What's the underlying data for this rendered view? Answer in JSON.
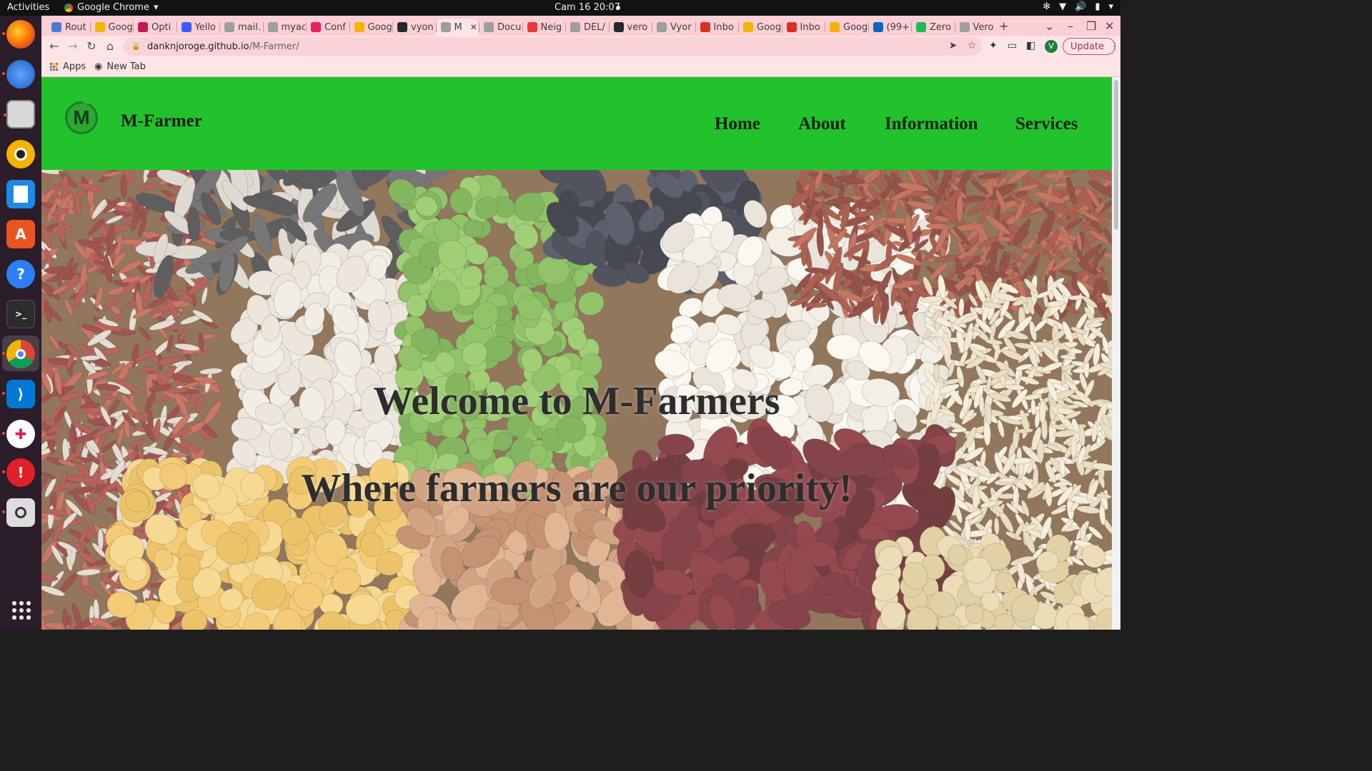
{
  "system": {
    "activities": "Activities",
    "app_name": "Google Chrome",
    "clock": "Cam 16  20:07"
  },
  "dock": {
    "apps": [
      "Firefox",
      "Thunderbird",
      "Files",
      "Rhythmbox",
      "LibreOffice Writer",
      "Ubuntu Software",
      "Help",
      "Terminal",
      "Google Chrome",
      "Visual Studio Code",
      "Slack",
      "Update Notifier",
      "Magnifier"
    ]
  },
  "browser": {
    "tabs": [
      {
        "label": "Rout",
        "color": "#4a7bd5"
      },
      {
        "label": "Goog",
        "color": "#f4b400"
      },
      {
        "label": "Opti",
        "color": "#c2185b"
      },
      {
        "label": "Yello",
        "color": "#3d5afe"
      },
      {
        "label": "mail.",
        "color": "#9e9e9e"
      },
      {
        "label": "myac",
        "color": "#9e9e9e"
      },
      {
        "label": "Conf",
        "color": "#e91e63"
      },
      {
        "label": "Goog",
        "color": "#f4b400"
      },
      {
        "label": "vyon",
        "color": "#24292e"
      },
      {
        "label": "M",
        "color": "#9e9e9e"
      },
      {
        "label": "Docu",
        "color": "#9e9e9e"
      },
      {
        "label": "Neig",
        "color": "#e53935"
      },
      {
        "label": "DEL/",
        "color": "#9e9e9e"
      },
      {
        "label": "vero",
        "color": "#24292e"
      },
      {
        "label": "Vyor",
        "color": "#9e9e9e"
      },
      {
        "label": "Inbo",
        "color": "#d93025"
      },
      {
        "label": "Goog",
        "color": "#f4b400"
      },
      {
        "label": "Inbo",
        "color": "#d93025"
      },
      {
        "label": "Goog",
        "color": "#f4b400"
      },
      {
        "label": "(99+",
        "color": "#0a66c2"
      },
      {
        "label": "Zero",
        "color": "#1db954"
      },
      {
        "label": "Vero",
        "color": "#9e9e9e"
      }
    ],
    "active_tab_index": 9,
    "url_host": "danknjoroge.github.io",
    "url_path": "/M-Farmer/",
    "profile_initial": "V",
    "update_label": "Update",
    "bookmarks": {
      "apps": "Apps",
      "new_tab": "New Tab"
    }
  },
  "site": {
    "logo_letter": "M",
    "brand": "M-Farmer",
    "nav": [
      "Home",
      "About",
      "Information",
      "Services"
    ],
    "hero_title": "Welcome to M-Farmers",
    "hero_subtitle": "Where farmers are our priority!",
    "colors": {
      "nav_bg": "#22c22c",
      "browser_theme": "#fccfd5"
    }
  }
}
